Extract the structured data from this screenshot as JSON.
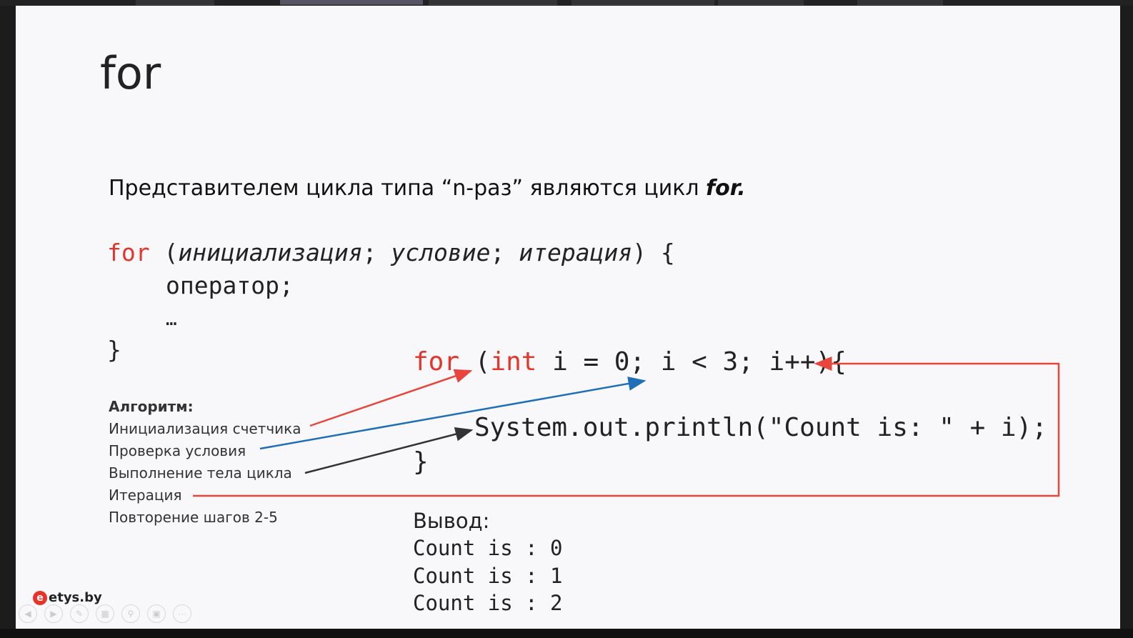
{
  "slide": {
    "title": "for",
    "intro_text": "Представителем цикла типа “n-раз” являются цикл ",
    "intro_keyword": "for."
  },
  "syntax": {
    "kw_for": "for",
    "open_paren": " (",
    "init": "инициализация",
    "sep1": "; ",
    "cond": "условие",
    "sep2": "; ",
    "iter": "итерация",
    "close": ") {",
    "body_line": "оператор;",
    "ellipsis": "…",
    "close_brace": "}"
  },
  "algorithm": {
    "heading": "Алгоритм:",
    "steps": [
      "Инициализация счетчика",
      "Проверка условия",
      "Выполнение тела цикла",
      "Итерация",
      "Повторение шагов 2-5"
    ]
  },
  "example": {
    "kw_for": "for",
    "space": " ",
    "paren": "(",
    "kw_int": "int",
    "rest": " i = 0; i < 3; i++){",
    "body": "System.out.println(\"Count is: \" + i);",
    "close_brace": "}"
  },
  "output": {
    "label": "Вывод:",
    "lines": [
      "Count is : 0",
      "Count is : 1",
      "Count is : 2"
    ]
  },
  "logo": {
    "mark": "e",
    "text": "etys.by"
  },
  "colors": {
    "keyword": "#e5352a",
    "arrow_red": "#e8453c",
    "arrow_blue": "#1f6fb8",
    "arrow_dark": "#333333"
  },
  "controls": [
    "prev-icon",
    "next-icon",
    "pen-icon",
    "slides-icon",
    "zoom-icon",
    "subtitle-icon",
    "more-icon"
  ]
}
